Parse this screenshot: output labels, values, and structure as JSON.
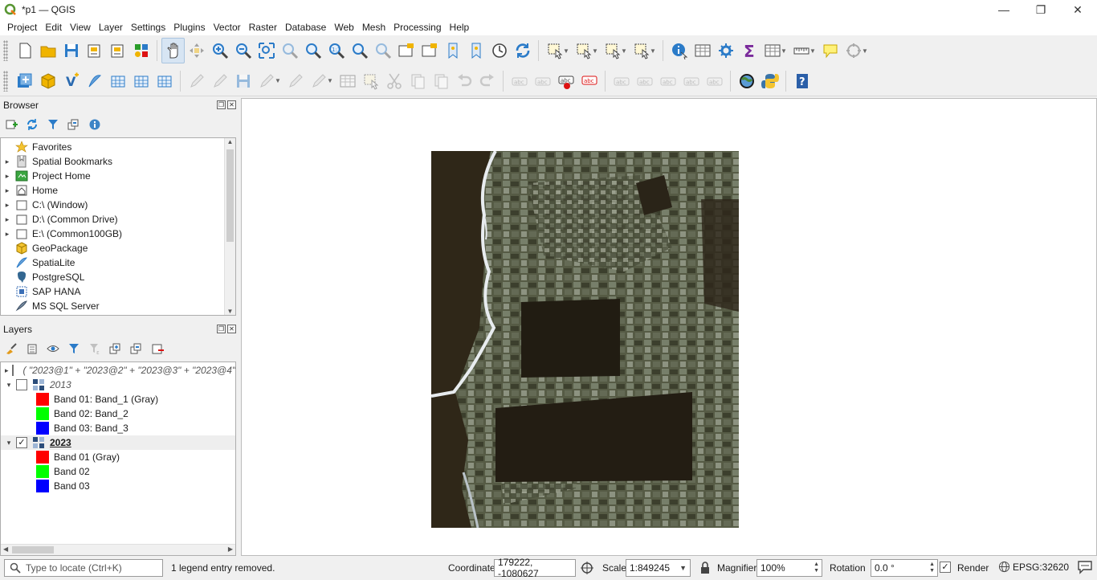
{
  "window": {
    "title": "*p1 — QGIS",
    "min": "—",
    "max": "❐",
    "close": "✕"
  },
  "menu": [
    "Project",
    "Edit",
    "View",
    "Layer",
    "Settings",
    "Plugins",
    "Vector",
    "Raster",
    "Database",
    "Web",
    "Mesh",
    "Processing",
    "Help"
  ],
  "toolbar1": [
    {
      "name": "new-project-icon"
    },
    {
      "name": "open-project-icon"
    },
    {
      "name": "save-project-icon"
    },
    {
      "name": "new-print-layout-icon"
    },
    {
      "name": "layout-manager-icon"
    },
    {
      "name": "style-manager-icon"
    },
    {
      "sep": true
    },
    {
      "name": "pan-map-icon",
      "active": true
    },
    {
      "name": "pan-to-selection-icon",
      "dis": true
    },
    {
      "name": "zoom-in-icon"
    },
    {
      "name": "zoom-out-icon"
    },
    {
      "name": "zoom-full-icon"
    },
    {
      "name": "zoom-to-selection-icon",
      "dis": true
    },
    {
      "name": "zoom-to-layer-icon"
    },
    {
      "name": "zoom-native-icon"
    },
    {
      "name": "zoom-last-icon"
    },
    {
      "name": "zoom-next-icon",
      "dis": true
    },
    {
      "name": "new-map-view-icon"
    },
    {
      "name": "new-3d-view-icon"
    },
    {
      "name": "new-bookmark-icon"
    },
    {
      "name": "show-bookmarks-icon"
    },
    {
      "name": "temporal-controller-icon"
    },
    {
      "name": "refresh-icon"
    },
    {
      "sep": true
    },
    {
      "name": "select-features-icon",
      "dd": true
    },
    {
      "name": "deselect-features-icon",
      "dd": true
    },
    {
      "name": "deselect-all-icon",
      "dd": true
    },
    {
      "name": "select-by-location-icon",
      "dd": true
    },
    {
      "sep": true
    },
    {
      "name": "identify-icon"
    },
    {
      "name": "attribute-table-icon"
    },
    {
      "name": "toolbox-icon"
    },
    {
      "name": "statistics-icon"
    },
    {
      "name": "open-table-icon",
      "dd": true
    },
    {
      "name": "measure-icon",
      "dd": true
    },
    {
      "name": "map-tips-icon"
    },
    {
      "name": "annotation-icon",
      "dd": true
    }
  ],
  "toolbar2": [
    {
      "name": "data-source-manager-icon"
    },
    {
      "name": "new-geopackage-icon"
    },
    {
      "name": "new-shapefile-icon"
    },
    {
      "name": "new-spatialite-icon"
    },
    {
      "name": "new-virtual-layer-icon"
    },
    {
      "name": "new-temporary-layer-icon"
    },
    {
      "name": "add-mesh-layer-icon"
    },
    {
      "sep": true
    },
    {
      "name": "edits-icon",
      "dis": true
    },
    {
      "name": "toggle-editing-icon",
      "dis": true
    },
    {
      "name": "save-edits-icon",
      "dis": true
    },
    {
      "name": "digitize-icon",
      "dis": true,
      "dd": true
    },
    {
      "name": "vertex-tool-icon",
      "dis": true
    },
    {
      "name": "modify-attributes-icon",
      "dis": true,
      "dd": true
    },
    {
      "name": "edit-table-icon",
      "dis": true
    },
    {
      "name": "delete-selected-icon",
      "dis": true
    },
    {
      "name": "cut-features-icon",
      "dis": true
    },
    {
      "name": "copy-features-icon",
      "dis": true
    },
    {
      "name": "paste-features-icon",
      "dis": true
    },
    {
      "name": "undo-icon",
      "dis": true
    },
    {
      "name": "redo-icon",
      "dis": true
    },
    {
      "sep": true
    },
    {
      "name": "label-toolbar-icon",
      "dis": true
    },
    {
      "name": "label-rule-icon",
      "dis": true
    },
    {
      "name": "layer-labeling-icon"
    },
    {
      "name": "label-pin-icon"
    },
    {
      "sep": true
    },
    {
      "name": "highlight-pinned-icon",
      "dis": true
    },
    {
      "name": "show-hide-labels-icon",
      "dis": true
    },
    {
      "name": "move-label-icon",
      "dis": true
    },
    {
      "name": "rotate-label-icon",
      "dis": true
    },
    {
      "name": "change-label-icon",
      "dis": true
    },
    {
      "sep": true
    },
    {
      "name": "globe-icon"
    },
    {
      "name": "python-console-icon"
    },
    {
      "sep": true
    },
    {
      "name": "help-icon"
    }
  ],
  "browser": {
    "title": "Browser",
    "items": [
      {
        "label": "Favorites",
        "icon": "star-icon",
        "exp": ""
      },
      {
        "label": "Spatial Bookmarks",
        "icon": "bookmark-icon",
        "exp": "▸"
      },
      {
        "label": "Project Home",
        "icon": "project-home-icon",
        "exp": "▸"
      },
      {
        "label": "Home",
        "icon": "home-icon",
        "exp": "▸"
      },
      {
        "label": "C:\\ (Window)",
        "icon": "drive-icon",
        "exp": "▸"
      },
      {
        "label": "D:\\ (Common Drive)",
        "icon": "drive-icon",
        "exp": "▸"
      },
      {
        "label": "E:\\ (Common100GB)",
        "icon": "drive-icon",
        "exp": "▸"
      },
      {
        "label": "GeoPackage",
        "icon": "geopackage-icon",
        "exp": ""
      },
      {
        "label": "SpatiaLite",
        "icon": "spatialite-icon",
        "exp": ""
      },
      {
        "label": "PostgreSQL",
        "icon": "postgresql-icon",
        "exp": ""
      },
      {
        "label": "SAP HANA",
        "icon": "sap-hana-icon",
        "exp": ""
      },
      {
        "label": "MS SQL Server",
        "icon": "mssql-icon",
        "exp": ""
      }
    ]
  },
  "layers": {
    "title": "Layers",
    "rows": [
      {
        "label": "( \"2023@1\" + \"2023@2\" + \"2023@3\" + \"2023@4\"",
        "type": "layer",
        "exp": "▸",
        "checked": false,
        "style": "italic"
      },
      {
        "label": "2013",
        "type": "layer",
        "exp": "▾",
        "checked": false,
        "style": "italic"
      },
      {
        "label": "Band 01: Band_1 (Gray)",
        "type": "band",
        "color": "#ff0000"
      },
      {
        "label": "Band 02: Band_2",
        "type": "band",
        "color": "#00ff00"
      },
      {
        "label": "Band 03: Band_3",
        "type": "band",
        "color": "#0000ff"
      },
      {
        "label": "2023",
        "type": "layer",
        "exp": "▾",
        "checked": true,
        "style": "bold"
      },
      {
        "label": "Band 01 (Gray)",
        "type": "band",
        "color": "#ff0000"
      },
      {
        "label": "Band 02",
        "type": "band",
        "color": "#00ff00"
      },
      {
        "label": "Band 03",
        "type": "band",
        "color": "#0000ff"
      }
    ]
  },
  "status": {
    "locate_placeholder": "Type to locate (Ctrl+K)",
    "message": "1 legend entry removed.",
    "coordinate_label": "Coordinate",
    "coordinate_value": "179222, -1080627",
    "scale_label": "Scale",
    "scale_value": "1:849245",
    "magnifier_label": "Magnifier",
    "magnifier_value": "100%",
    "rotation_label": "Rotation",
    "rotation_value": "0.0 °",
    "render_label": "Render",
    "crs": "EPSG:32620"
  }
}
